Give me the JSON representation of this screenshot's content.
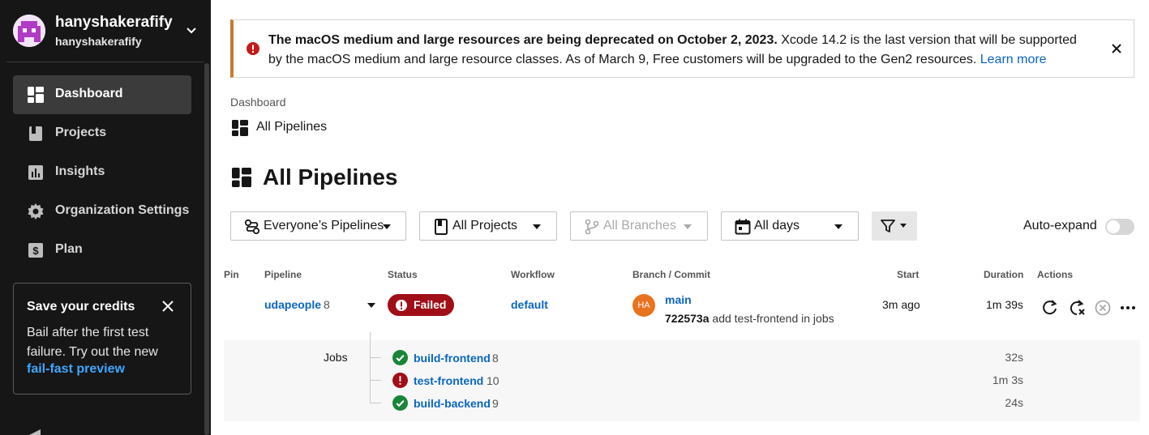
{
  "user": {
    "name": "hanyshakerafify",
    "org": "hanyshakerafify"
  },
  "sidebar": {
    "items": [
      {
        "label": "Dashboard",
        "icon": "dashboard-icon",
        "active": true
      },
      {
        "label": "Projects",
        "icon": "projects-icon"
      },
      {
        "label": "Insights",
        "icon": "insights-icon"
      },
      {
        "label": "Organization Settings",
        "icon": "gear-icon"
      },
      {
        "label": "Plan",
        "icon": "dollar-icon"
      }
    ],
    "credits": {
      "title": "Save your credits",
      "body": "Bail after the first test failure. Try out the new",
      "link": "fail-fast preview"
    }
  },
  "banner": {
    "bold": "The macOS medium and large resources are being deprecated on October 2, 2023.",
    "text": " Xcode 14.2 is the last version that will be supported by the macOS medium and large resource classes. As of March 9, Free customers will be upgraded to the Gen2 resources. ",
    "link": "Learn more",
    "accent": "#c57c2b"
  },
  "breadcrumb": {
    "parent": "Dashboard",
    "current": "All Pipelines"
  },
  "page_title": "All Pipelines",
  "filters": {
    "pipelines": "Everyone’s Pipelines",
    "projects": "All Projects",
    "branches": "All Branches",
    "days": "All days",
    "auto_expand": "Auto-expand"
  },
  "table": {
    "headers": {
      "pin": "Pin",
      "pipeline": "Pipeline",
      "status": "Status",
      "workflow": "Workflow",
      "branch_commit": "Branch / Commit",
      "start": "Start",
      "duration": "Duration",
      "actions": "Actions"
    },
    "row": {
      "project": "udapeople",
      "number": "8",
      "status": "Failed",
      "status_color": "#a00e17",
      "workflow": "default",
      "avatar_initials": "HA",
      "branch": "main",
      "commit_hash": "722573a",
      "commit_message": "add test-frontend in jobs",
      "start": "3m ago",
      "duration": "1m 39s"
    },
    "jobs_label": "Jobs",
    "jobs": [
      {
        "name": "build-frontend",
        "number": "8",
        "status": "success",
        "duration": "32s"
      },
      {
        "name": "test-frontend",
        "number": "10",
        "status": "failed",
        "duration": "1m 3s"
      },
      {
        "name": "build-backend",
        "number": "9",
        "status": "success",
        "duration": "24s"
      }
    ]
  }
}
